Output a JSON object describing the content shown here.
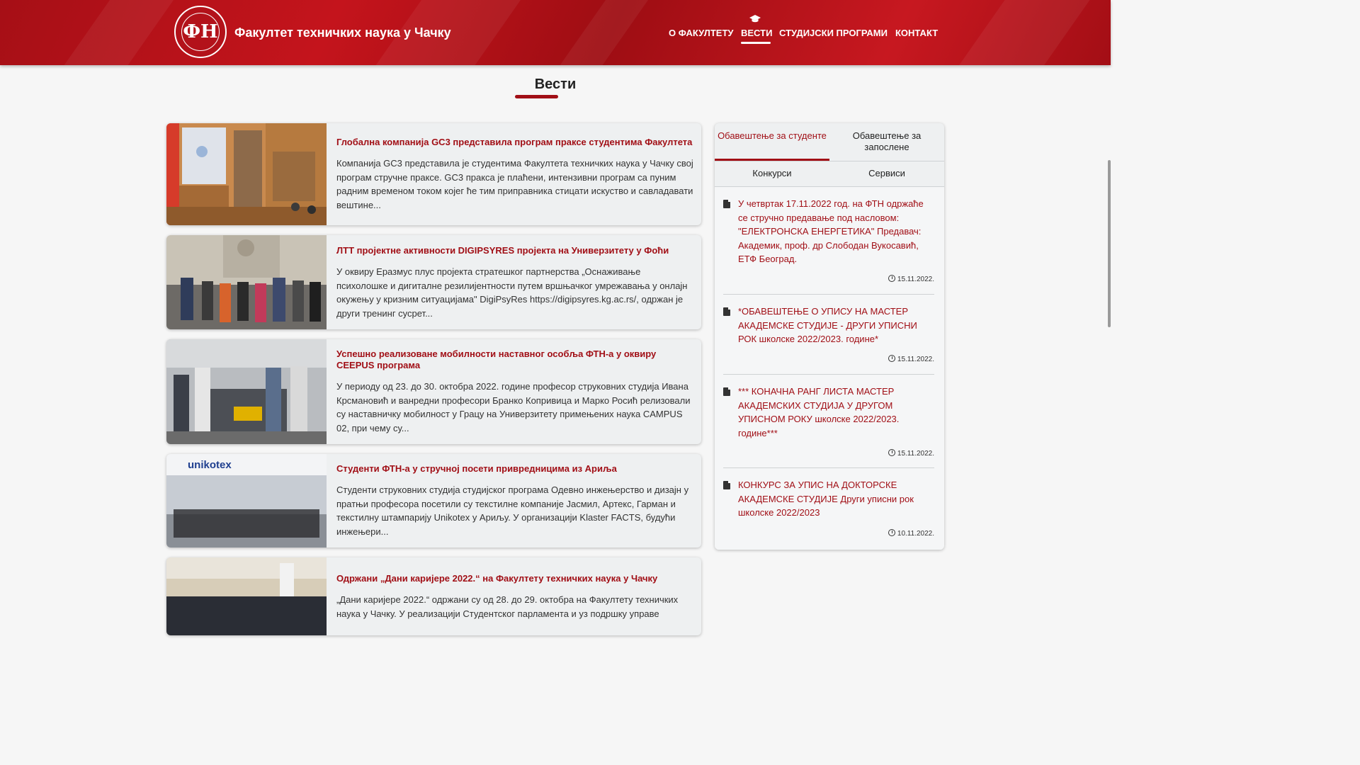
{
  "header": {
    "logo_text": "ФН",
    "site_title": "Факултет техничких наука у Чачку",
    "nav": [
      {
        "label": "О ФАКУЛТЕТУ"
      },
      {
        "label": "ВЕСТИ",
        "active": true,
        "icon": "graduation-cap-icon"
      },
      {
        "label": "СТУДИЈСКИ ПРОГРАМИ"
      },
      {
        "label": "КОНТАКТ"
      }
    ]
  },
  "page_title": "Вести",
  "news": [
    {
      "title": "Глобална компанија GC3 представила програм праксе студентима Факултета",
      "body": "Компанија GC3 представила је студентима Факултета техничких наука у Чачку свој програм стручне праксе. GC3 пракса је плаћени, интензивни програм са пуним радним временом током којег ће тим приправника стицати искуство и савладавати вештине..."
    },
    {
      "title": "ЛТТ пројектне активности DIGIPSYRES пројекта на Универзитету у Фоћи",
      "body": "У оквиру Еразмус плус пројекта стратешког партнерства „Оснаживање психолошке и дигиталне резилијентности путем вршњачког умрежавања у онлајн окужењу у кризним ситуацијама\" DigiPsyRes https://digipsyres.kg.ac.rs/, одржан је други тренинг сусрет..."
    },
    {
      "title": "Успешно реализоване мобилности наставног особља ФТН-а у оквиру CEEPUS програма",
      "body": "У периоду од 23. до 30. октобра 2022. године професор струковних студија Ивана Крсмановић и ванредни професори Бранко Копривица и Марко Росић релизовали су наставничку мобилност у Грацу на Универзитету примењених наука CAMPUS 02, при чему су..."
    },
    {
      "title": "Студенти ФТН-а у стручној посети привредницима из Ариља",
      "body": "Студенти струковних студија студијског програма Одевно инжењерство и дизајн у пратњи професора посетили су текстилне компаније Јасмил, Артекс, Гарман и текстилну штампарију Unikotex у Ариљу. У организацији Klaster FACTS, будући инжењери...",
      "thumb_sign": "unikotex"
    },
    {
      "title": "Одржани „Дани каријере 2022.“ на Факултету техничких наука у Чачку",
      "body": "„Дани каријере 2022.“ одржани су од 28. до 29. октобра на Факултету техничких наука у Чачку. У реализацији Студентског парламента и уз подршку управе"
    }
  ],
  "sidebar": {
    "tabs": [
      {
        "label": "Обавештење за студенте",
        "active": true
      },
      {
        "label": "Обавештење за запослене"
      },
      {
        "label": "Конкурси"
      },
      {
        "label": "Сервиси"
      }
    ],
    "notices": [
      {
        "text": "У четвртак 17.11.2022 год. на ФТН одржаће се стручно предавање под насловом: \"ЕЛЕКТРОНСКА ЕНЕРГЕТИКА\" Предавач: Академик, проф. др Слободан Вукосавић, ЕТФ Београд.",
        "date": "15.11.2022."
      },
      {
        "text": "*ОБАВЕШТЕЊЕ О УПИСУ НА МАСТЕР АКАДЕМСКЕ СТУДИЈЕ - ДРУГИ УПИСНИ РОК школске 2022/2023. године*",
        "date": "15.11.2022."
      },
      {
        "text": "*** КОНАЧНА РАНГ ЛИСТА МАСТЕР АКАДЕМСКИХ СТУДИЈА У ДРУГОМ УПИСНОМ РОКУ школске 2022/2023. године***",
        "date": "15.11.2022."
      },
      {
        "text": "КОНКУРС ЗА УПИС НА ДОКТОРСКЕ АКАДЕМСКЕ СТУДИЈЕ Други уписни рок школске 2022/2023",
        "date": "10.11.2022."
      }
    ]
  },
  "colors": {
    "brand_red": "#a10f16",
    "header_red": "#c4141c",
    "card_bg": "#eef0f1"
  }
}
